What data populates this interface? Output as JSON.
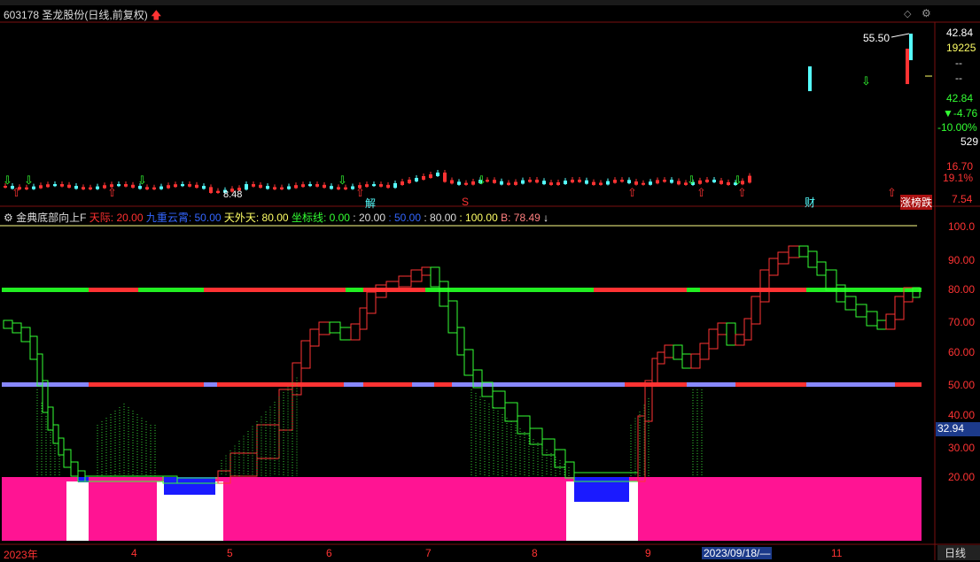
{
  "stock": {
    "code": "603178",
    "name": "圣龙股份",
    "period_label": "(日线,前复权)"
  },
  "main_chart": {
    "price_max_label": "55.50",
    "price_min_label": "8.48",
    "right_values": {
      "top": "42.84",
      "volume": "19225",
      "dash1": "--",
      "dash2": "--",
      "price": "42.84",
      "change": "▼-4.76",
      "change_pct": "-10.00%",
      "vol2": "529",
      "axis_high": "16.70",
      "axis_pct": "19.1%",
      "axis_low": "7.54"
    },
    "markers": {
      "jie": "解",
      "s": "S",
      "cai": "财",
      "zhangtie": "涨榜跌"
    }
  },
  "indicator": {
    "name": "金典底部向上F",
    "params": [
      {
        "label": "天际: 20.00",
        "color": "#ff3030"
      },
      {
        "label": "九重云霄: 50.00",
        "color": "#3366ff"
      },
      {
        "label": "天外天: 80.00",
        "color": "#ffff66"
      },
      {
        "label": "坐标线: 0.00",
        "color": "#33ff33"
      },
      {
        "label": ": 20.00",
        "color": "#dddddd"
      },
      {
        "label": ": 50.00",
        "color": "#3366ff"
      },
      {
        "label": ": 80.00",
        "color": "#dddddd"
      },
      {
        "label": ": 100.00",
        "color": "#ffff66"
      },
      {
        "label": "B: 78.49",
        "color": "#ff8080"
      }
    ],
    "y_axis": [
      "100.0",
      "90.00",
      "80.00",
      "70.00",
      "60.00",
      "50.00",
      "40.00",
      "30.00",
      "20.00"
    ],
    "current_value": "32.94"
  },
  "x_axis": {
    "labels": [
      "2023年",
      "4",
      "5",
      "6",
      "7",
      "8",
      "9",
      "2023/09/18/—",
      "11"
    ],
    "period_button": "日线"
  },
  "colors": {
    "up": "#ff3333",
    "down": "#55ffff",
    "magenta": "#ff1493",
    "green": "#22ee22",
    "lavender": "#8888ff"
  }
}
